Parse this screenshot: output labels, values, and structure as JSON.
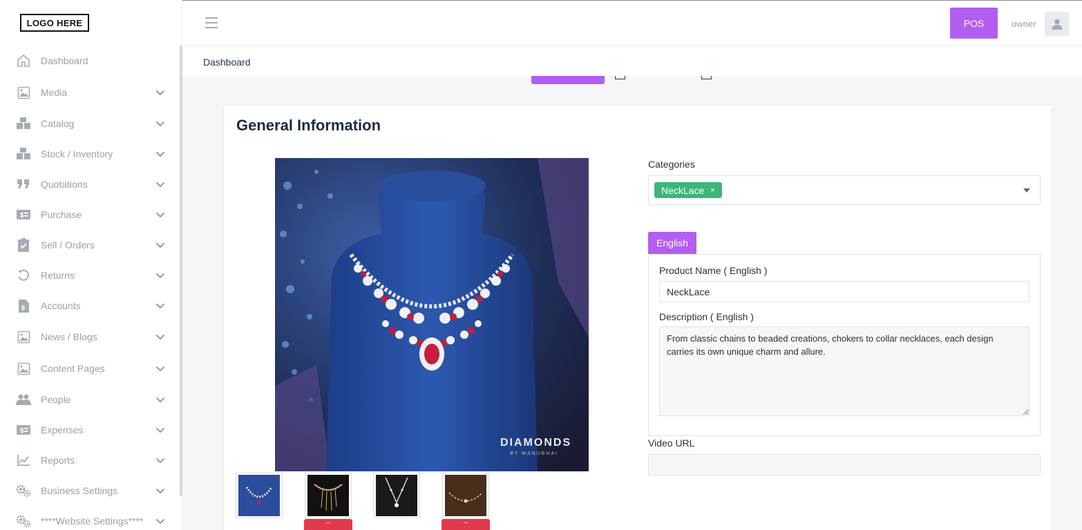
{
  "brand": {
    "logo_text": "LOGO HERE"
  },
  "sidebar": {
    "items": [
      {
        "label": "Dashboard",
        "icon": "home-icon",
        "expandable": false
      },
      {
        "label": "Media",
        "icon": "image-icon",
        "expandable": true
      },
      {
        "label": "Catalog",
        "icon": "boxes-icon",
        "expandable": true
      },
      {
        "label": "Stock / Inventory",
        "icon": "boxes-icon",
        "expandable": true
      },
      {
        "label": "Quotations",
        "icon": "quote-icon",
        "expandable": true
      },
      {
        "label": "Purchase",
        "icon": "money-bill-icon",
        "expandable": true
      },
      {
        "label": "Sell / Orders",
        "icon": "clipboard-check-icon",
        "expandable": true
      },
      {
        "label": "Returns",
        "icon": "undo-icon",
        "expandable": true
      },
      {
        "label": "Accounts",
        "icon": "invoice-icon",
        "expandable": true
      },
      {
        "label": "News / Blogs",
        "icon": "image-icon",
        "expandable": true
      },
      {
        "label": "Content Pages",
        "icon": "image-icon",
        "expandable": true
      },
      {
        "label": "People",
        "icon": "users-icon",
        "expandable": true
      },
      {
        "label": "Expenses",
        "icon": "money-bill-icon",
        "expandable": true
      },
      {
        "label": "Reports",
        "icon": "line-chart-icon",
        "expandable": true
      },
      {
        "label": "Business Settings",
        "icon": "gears-icon",
        "expandable": true
      },
      {
        "label": "****Website Settings****",
        "icon": "gears-icon",
        "expandable": true
      }
    ]
  },
  "topbar": {
    "pos_label": "POS",
    "user_name": "owner"
  },
  "breadcrumb": {
    "current": "Dashboard"
  },
  "card": {
    "title": "General Information",
    "main_image_caption": "DIAMONDS",
    "main_image_subcaption": "BY MANUBHAI",
    "thumbnails": [
      {
        "name": "necklace-thumb-1",
        "delete_label": ""
      },
      {
        "name": "necklace-thumb-2",
        "delete_label": "–"
      },
      {
        "name": "necklace-thumb-3",
        "delete_label": ""
      },
      {
        "name": "necklace-thumb-4",
        "delete_label": "–"
      }
    ]
  },
  "form": {
    "categories_label": "Categories",
    "selected_category": "NeckLace",
    "chip_remove": "×",
    "language_tab": "English",
    "product_name_label": "Product Name ( English )",
    "product_name_value": "NeckLace",
    "description_label": "Description ( English )",
    "description_value": "From classic chains to beaded creations, chokers to collar necklaces, each design carries its own unique charm and allure.",
    "video_url_label": "Video URL",
    "video_url_value": ""
  },
  "colors": {
    "accent": "#b35ef0",
    "chip_green": "#3db67a",
    "delete_red": "#e23a4d",
    "nav_text": "#9aa0a8",
    "title_dark": "#1d2b3e"
  }
}
